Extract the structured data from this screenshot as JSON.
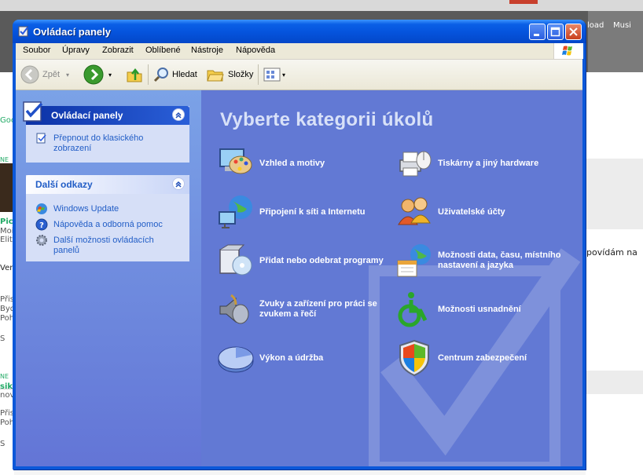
{
  "window": {
    "title": "Ovládací panely"
  },
  "menubar": {
    "items": [
      "Soubor",
      "Úpravy",
      "Zobrazit",
      "Oblíbené",
      "Nástroje",
      "Nápověda"
    ]
  },
  "toolbar": {
    "back_label": "Zpět",
    "search_label": "Hledat",
    "folders_label": "Složky"
  },
  "taskpane": {
    "panel_title": "Ovládací panely",
    "switch_link": "Přepnout do klasického zobrazení",
    "links_title": "Další odkazy",
    "links": [
      "Windows Update",
      "Nápověda a odborná pomoc",
      "Další možnosti ovládacích panelů"
    ]
  },
  "main": {
    "heading": "Vyberte kategorii úkolů",
    "categories": [
      {
        "label": "Vzhled a motivy",
        "icon": "appearance-icon"
      },
      {
        "label": "Tiskárny a jiný hardware",
        "icon": "printer-icon"
      },
      {
        "label": "Připojení k síti a Internetu",
        "icon": "network-icon"
      },
      {
        "label": "Uživatelské účty",
        "icon": "users-icon"
      },
      {
        "label": "Přidat nebo odebrat programy",
        "icon": "add-remove-icon"
      },
      {
        "label": "Možnosti data, času, místního nastavení a jazyka",
        "icon": "date-time-icon"
      },
      {
        "label": "Zvuky a zařízení pro práci se zvukem a řečí",
        "icon": "sound-icon"
      },
      {
        "label": "Možnosti usnadnění",
        "icon": "accessibility-icon"
      },
      {
        "label": "Výkon a údržba",
        "icon": "performance-icon"
      },
      {
        "label": "Centrum zabezpečení",
        "icon": "security-shield-icon"
      }
    ]
  },
  "background": {
    "right_texts": [
      "load",
      "Musi",
      "povídám na"
    ],
    "left_texts": [
      "Goo",
      "NE",
      "Pic",
      "Moi",
      "Elit",
      "Ver",
      "Přis",
      "Byd",
      "Poh",
      "S",
      "NE",
      "sika",
      "nov",
      "Přis",
      "Poh",
      "S"
    ]
  },
  "colors": {
    "titlebar": "#0553dc",
    "taskpane": "#7ba2e7",
    "main_bg": "#6279d4",
    "link": "#215dc6"
  }
}
